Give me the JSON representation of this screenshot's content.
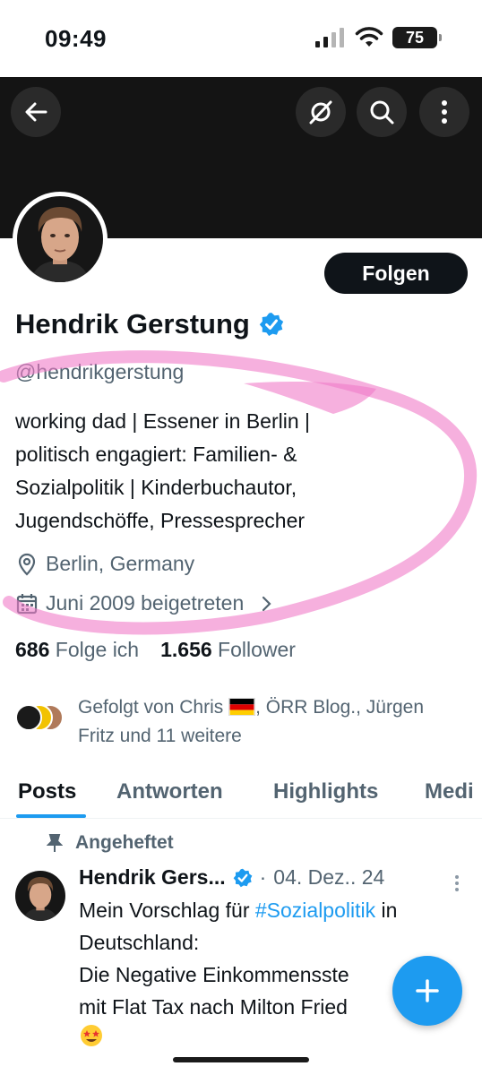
{
  "status_bar": {
    "time": "09:49",
    "battery": "75"
  },
  "header": {
    "back_icon": "arrow-left-icon",
    "grok_icon": "grok-icon",
    "search_icon": "search-icon",
    "more_icon": "more-vertical-icon"
  },
  "profile": {
    "follow_label": "Folgen",
    "display_name": "Hendrik Gerstung",
    "handle": "@hendrikgerstung",
    "bio_lines": [
      "working dad | Essener in Berlin |",
      "politisch engagiert: Familien- &",
      "Sozialpolitik | Kinderbuchautor,",
      "Jugendschöffe, Pressesprecher"
    ],
    "location": "Berlin, Germany",
    "joined": "Juni 2009 beigetreten",
    "following_count": "686",
    "following_label": "Folge ich",
    "followers_count": "1.656",
    "followers_label": "Follower",
    "followed_by_line1_prefix": "Gefolgt von Chris",
    "followed_by_line1_suffix": ", ÖRR Blog., Jürgen",
    "followed_by_line2": "Fritz und 11 weitere"
  },
  "tabs": [
    {
      "label": "Posts",
      "active": true
    },
    {
      "label": "Antworten",
      "active": false
    },
    {
      "label": "Highlights",
      "active": false
    },
    {
      "label": "Medi",
      "active": false
    }
  ],
  "post": {
    "pinned_label": "Angeheftet",
    "author": "Hendrik Gers...",
    "separator": "·",
    "date": "04. Dez.. 24",
    "line1_prefix": "Mein Vorschlag für ",
    "line1_hashtag": "#Sozialpolitik",
    "line1_suffix": " in",
    "line2": "Deutschland:",
    "line3": "Die Negative Einkommensste",
    "line4": "mit Flat Tax nach Milton Fried"
  },
  "colors": {
    "accent": "#1d9bf0",
    "annotation_pink": "#f07cc8",
    "banner": "#141414"
  }
}
